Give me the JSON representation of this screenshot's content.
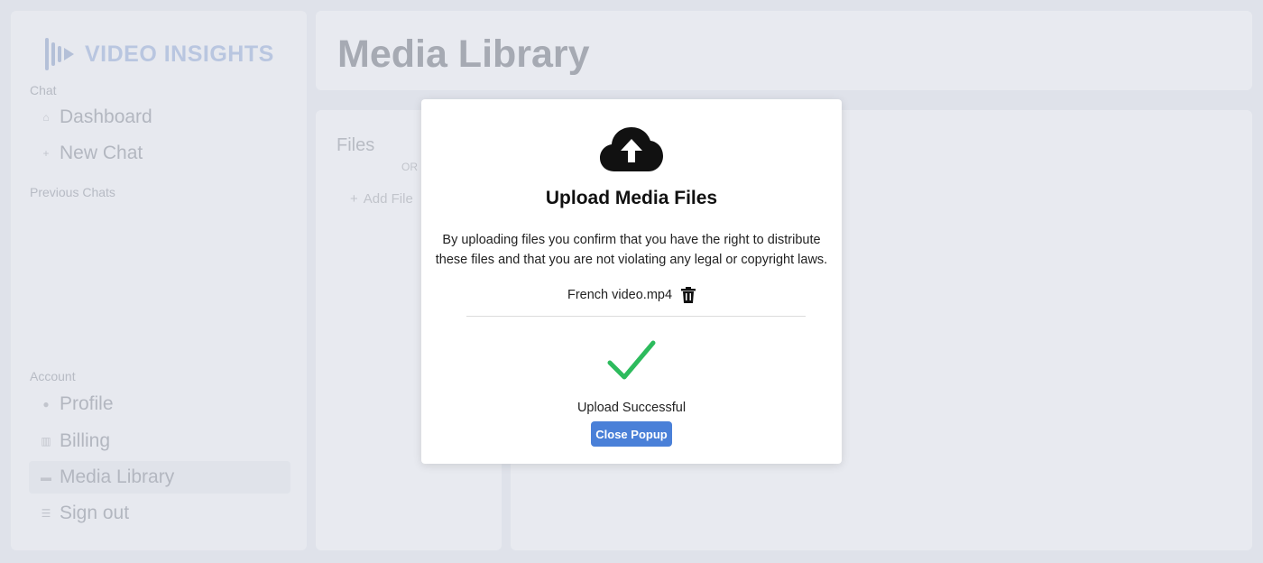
{
  "app": {
    "brand": "VIDEO INSIGHTS",
    "accent_color": "#4a80d8"
  },
  "sidebar": {
    "chat_label": "Chat",
    "chat_items": [
      {
        "label": "Dashboard",
        "icon": "home-icon"
      },
      {
        "label": "New Chat",
        "icon": "plus-icon"
      }
    ],
    "previous_chats_label": "Previous Chats",
    "account_label": "Account",
    "account_items": [
      {
        "label": "Profile",
        "icon": "user-icon"
      },
      {
        "label": "Billing",
        "icon": "billing-icon"
      },
      {
        "label": "Media Library",
        "icon": "folder-icon",
        "active": true
      },
      {
        "label": "Sign out",
        "icon": "sign-out-icon"
      }
    ]
  },
  "header": {
    "title": "Media Library"
  },
  "files_panel": {
    "title": "Files",
    "or_text": "OR",
    "add_file_label": "Add File"
  },
  "modal": {
    "title": "Upload Media Files",
    "description": "By uploading files you confirm that you have the right to distribute these files and that you are not violating any legal or copyright laws.",
    "file_name": "French video.mp4",
    "status": "Upload Successful",
    "close_label": "Close Popup",
    "success_color": "#2dbb5d"
  }
}
